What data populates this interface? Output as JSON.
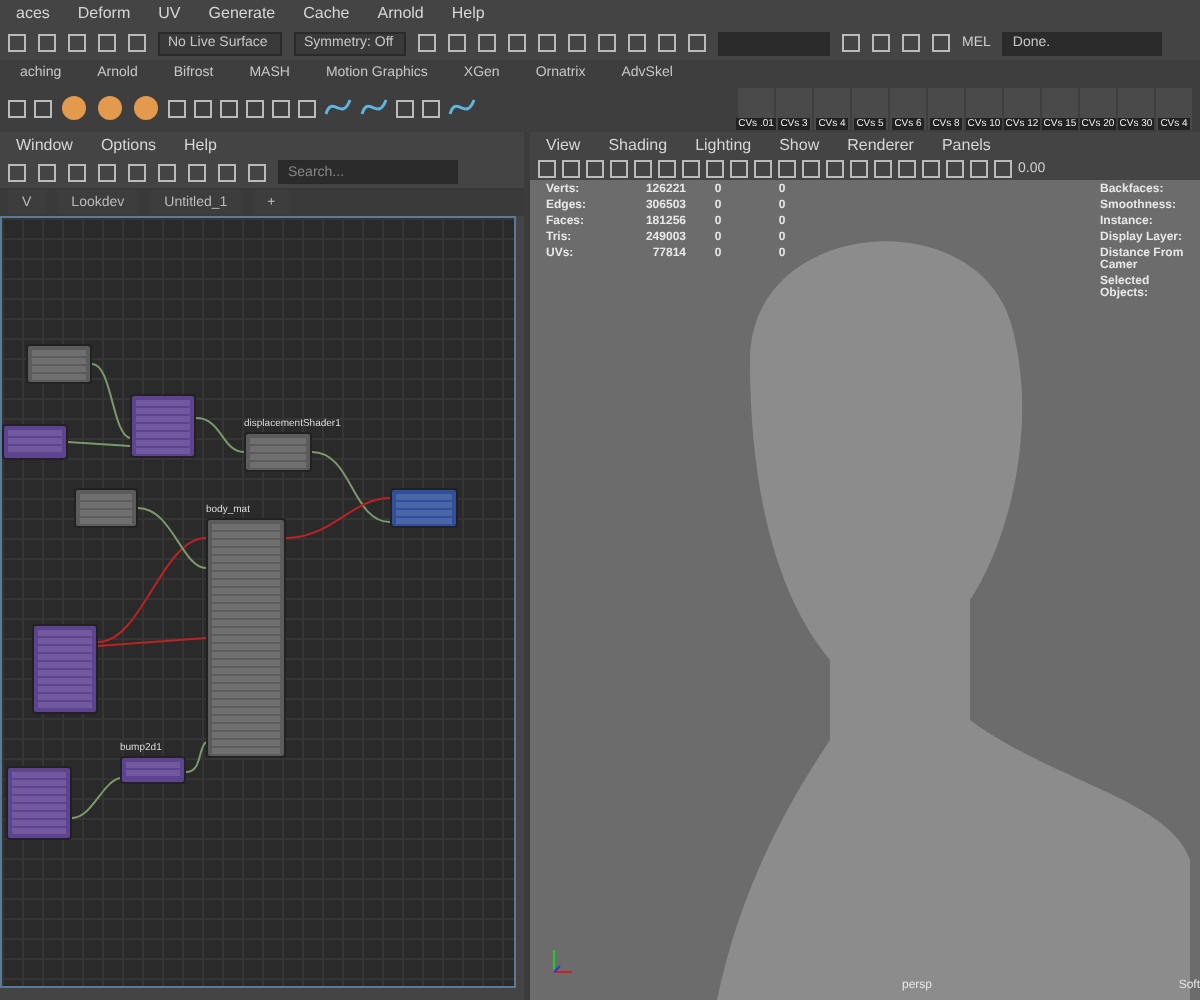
{
  "main_menu": [
    "aces",
    "Deform",
    "UV",
    "Generate",
    "Cache",
    "Arnold",
    "Help"
  ],
  "status_line": {
    "live_surface": "No Live Surface",
    "symmetry": "Symmetry: Off",
    "command_language": "MEL",
    "command_result": "Done."
  },
  "shelf_tabs": [
    "aching",
    "Arnold",
    "Bifrost",
    "MASH",
    "Motion Graphics",
    "XGen",
    "Ornatrix",
    "AdvSkel"
  ],
  "shelf_buttons": [
    "CVs .01",
    "CVs 3",
    "CVs 4",
    "CVs 5",
    "CVs 6",
    "CVs 8",
    "CVs 10",
    "CVs 12",
    "CVs 15",
    "CVs 20",
    "CVs 30",
    "CVs 4"
  ],
  "node_editor": {
    "menu": [
      "Window",
      "Options",
      "Help"
    ],
    "search": {
      "placeholder": "Search..."
    },
    "tabs": [
      "V",
      "Lookdev",
      "Untitled_1",
      "+"
    ],
    "nodes": [
      {
        "color": "#5c5c5c"
      },
      {
        "color": "#5e4391"
      },
      {
        "color": "#5e4391"
      },
      {
        "title": "displacementShader1",
        "color": "#5c5c5c"
      },
      {
        "color": "#31509c"
      },
      {
        "color": "#5c5c5c"
      },
      {
        "title": "body_mat",
        "color": "#5c5c5c"
      },
      {
        "color": "#5e4391"
      },
      {
        "color": "#5e4391"
      },
      {
        "title": "bump2d1",
        "color": "#5e4391"
      }
    ]
  },
  "viewport": {
    "menu": [
      "View",
      "Shading",
      "Lighting",
      "Show",
      "Renderer",
      "Panels"
    ],
    "field_value": "0.00",
    "stats": [
      {
        "label": "Verts:",
        "values": [
          "126221",
          "0",
          "0"
        ]
      },
      {
        "label": "Edges:",
        "values": [
          "306503",
          "0",
          "0"
        ]
      },
      {
        "label": "Faces:",
        "values": [
          "181256",
          "0",
          "0"
        ]
      },
      {
        "label": "Tris:",
        "values": [
          "249003",
          "0",
          "0"
        ]
      },
      {
        "label": "UVs:",
        "values": [
          "77814",
          "0",
          "0"
        ]
      }
    ],
    "info_labels": [
      "Backfaces:",
      "Smoothness:",
      "Instance:",
      "Display Layer:",
      "Distance From Camer",
      "Selected Objects:"
    ],
    "camera": "persp",
    "corner_text": "Soft"
  }
}
